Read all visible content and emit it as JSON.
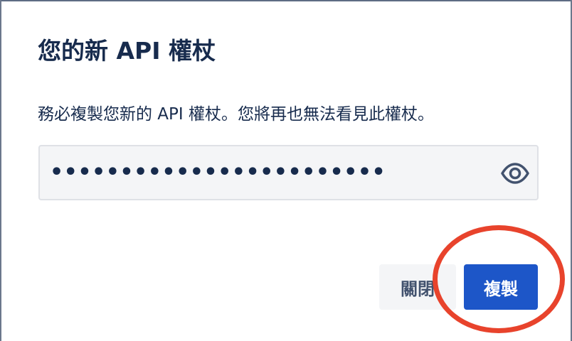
{
  "dialog": {
    "title": "您的新 API 權杖",
    "description": "務必複製您新的 API 權杖。您將再也無法看見此權杖。"
  },
  "token_field": {
    "masked_value": "••••••••••••••••••••••••",
    "reveal_icon": "eye-icon"
  },
  "actions": {
    "close_label": "關閉",
    "copy_label": "複製"
  },
  "colors": {
    "primary": "#1d56c8",
    "secondary_bg": "#f4f5f7",
    "text": "#172b4d",
    "annotation": "#e8432c"
  }
}
